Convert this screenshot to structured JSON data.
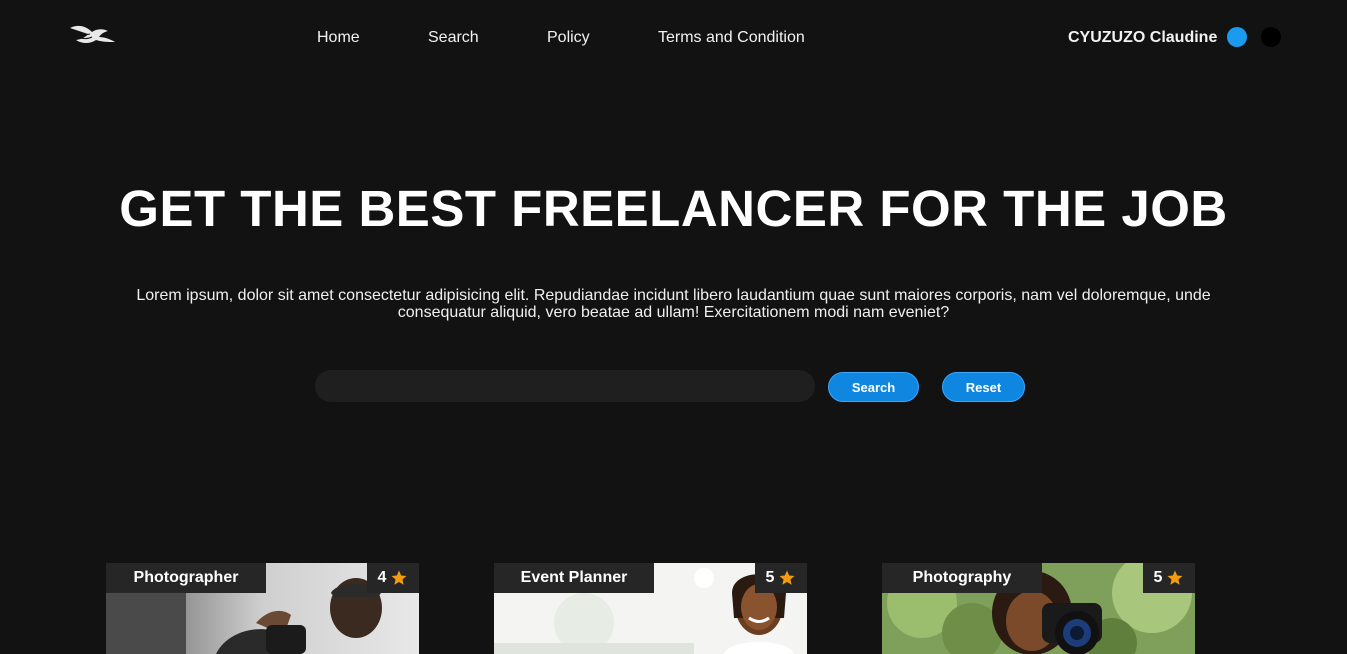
{
  "header": {
    "logo_icon": "bird-logo-icon",
    "nav": [
      {
        "label": "Home"
      },
      {
        "label": "Search"
      },
      {
        "label": "Policy"
      },
      {
        "label": "Terms and Condition"
      }
    ],
    "user_name": "CYUZUZO Claudine",
    "theme_colors": [
      "#1a9bf0",
      "#000000"
    ]
  },
  "hero": {
    "title": "GET THE BEST FREELANCER FOR THE JOB",
    "description": "Lorem ipsum, dolor sit amet consectetur adipisicing elit. Repudiandae incidunt libero laudantium quae sunt maiores corporis, nam vel doloremque, unde consequatur aliquid, vero beatae ad ullam! Exercitationem modi nam eveniet?"
  },
  "search": {
    "value": "",
    "search_label": "Search",
    "reset_label": "Reset"
  },
  "cards": [
    {
      "category": "Photographer",
      "rating": "4"
    },
    {
      "category": "Event Planner",
      "rating": "5"
    },
    {
      "category": "Photography",
      "rating": "5"
    }
  ],
  "colors": {
    "background": "#131213",
    "accent": "#0f86e0",
    "star": "#f39c12"
  }
}
